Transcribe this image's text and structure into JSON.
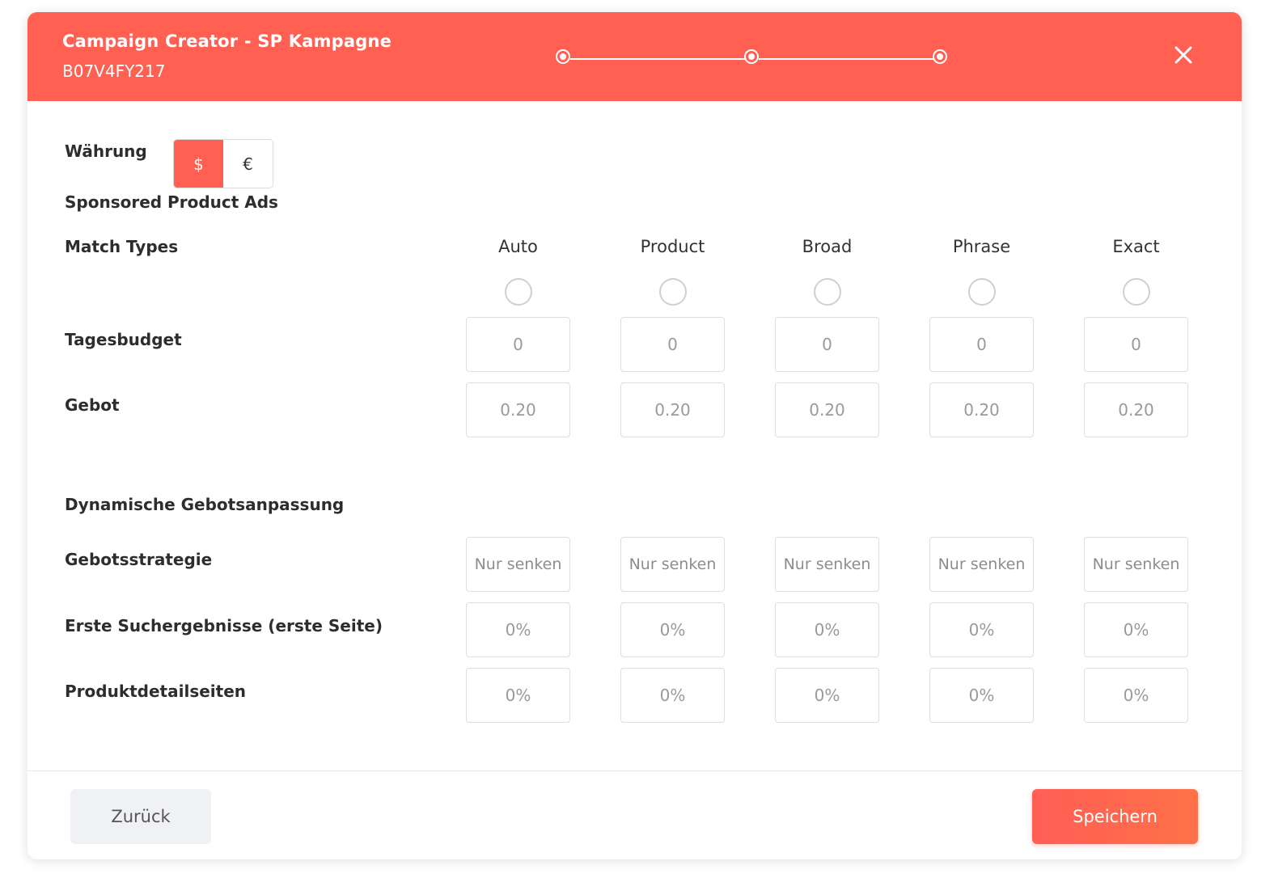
{
  "header": {
    "title": "Campaign Creator - SP Kampagne",
    "subtitle": "B07V4FY217",
    "steps": 3
  },
  "currency": {
    "label": "Währung",
    "options": [
      "$",
      "€"
    ],
    "selected": "$"
  },
  "section_sp": "Sponsored Product Ads",
  "match_types": {
    "label": "Match Types",
    "columns": [
      "Auto",
      "Product",
      "Broad",
      "Phrase",
      "Exact"
    ]
  },
  "tagesbudget": {
    "label": "Tagesbudget",
    "values": [
      "0",
      "0",
      "0",
      "0",
      "0"
    ]
  },
  "gebot": {
    "label": "Gebot",
    "values": [
      "0.20",
      "0.20",
      "0.20",
      "0.20",
      "0.20"
    ]
  },
  "section_dynamic": "Dynamische Gebotsanpassung",
  "gebotsstrategie": {
    "label": "Gebotsstrategie",
    "values": [
      "Nur senken",
      "Nur senken",
      "Nur senken",
      "Nur senken",
      "Nur senken"
    ]
  },
  "erste_suchergebnisse": {
    "label": "Erste Suchergebnisse (erste Seite)",
    "values": [
      "0%",
      "0%",
      "0%",
      "0%",
      "0%"
    ]
  },
  "produktdetailseiten": {
    "label": "Produktdetailseiten",
    "values": [
      "0%",
      "0%",
      "0%",
      "0%",
      "0%"
    ]
  },
  "footer": {
    "back_label": "Zurück",
    "save_label": "Speichern"
  },
  "colors": {
    "accent": "#ff6052"
  }
}
